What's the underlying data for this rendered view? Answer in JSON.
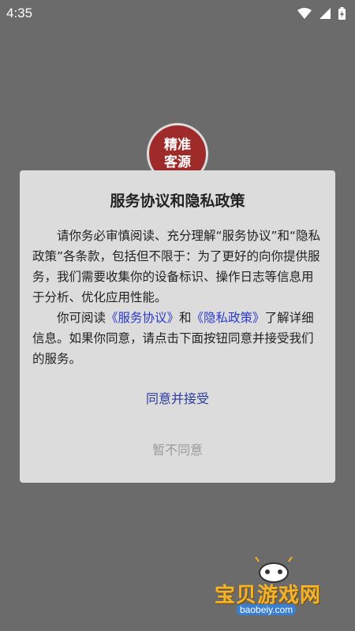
{
  "status_bar": {
    "time": "4:35",
    "icons": [
      "wifi-icon",
      "signal-icon",
      "battery-charging-icon"
    ]
  },
  "logo": {
    "line1": "精准",
    "line2": "客源",
    "color": "#9e2a2a"
  },
  "dialog": {
    "title": "服务协议和隐私政策",
    "para1": "请你务必审慎阅读、充分理解“服务协议”和“隐私政策”各条款，包括但不限于：为了更好的向你提供服务，我们需要收集你的设备标识、操作日志等信息用于分析、优化应用性能。",
    "para2_prefix": "你可阅读",
    "service_link": "《服务协议》",
    "para2_and": "和",
    "privacy_link": "《隐私政策》",
    "para2_suffix": "了解详细信息。如果你同意，请点击下面按钮同意并接受我们的服务。",
    "agree_label": "同意并接受",
    "disagree_label": "暂不同意",
    "link_color": "#2a3acb"
  },
  "watermark": {
    "text": "宝贝游戏网",
    "url": "baobeiy.com"
  }
}
